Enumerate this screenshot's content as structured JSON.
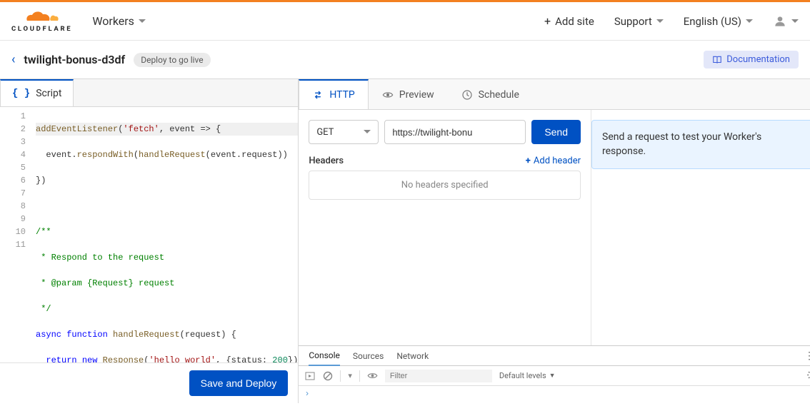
{
  "header": {
    "brand": "CLOUDFLARE",
    "nav_workers": "Workers",
    "add_site": "Add site",
    "support": "Support",
    "language": "English (US)"
  },
  "subheader": {
    "worker_name": "twilight-bonus-d3df",
    "deploy_badge": "Deploy to go live",
    "docs": "Documentation"
  },
  "script_tab": "Script",
  "code_lines": [
    "addEventListener('fetch', event => {",
    "  event.respondWith(handleRequest(event.request))",
    "})",
    "",
    "/**",
    " * Respond to the request",
    " * @param {Request} request",
    " */",
    "async function handleRequest(request) {",
    "  return new Response('hello world', {status: 200})",
    "}"
  ],
  "save_deploy": "Save and Deploy",
  "right_tabs": {
    "http": "HTTP",
    "preview": "Preview",
    "schedule": "Schedule"
  },
  "request": {
    "method": "GET",
    "url": "https://twilight-bonu",
    "send": "Send",
    "headers_label": "Headers",
    "add_header": "Add header",
    "no_headers": "No headers specified"
  },
  "info_box": "Send a request to test your Worker's response.",
  "devtools": {
    "tabs": {
      "console": "Console",
      "sources": "Sources",
      "network": "Network"
    },
    "filter_placeholder": "Filter",
    "levels": "Default levels",
    "prompt": "›"
  }
}
